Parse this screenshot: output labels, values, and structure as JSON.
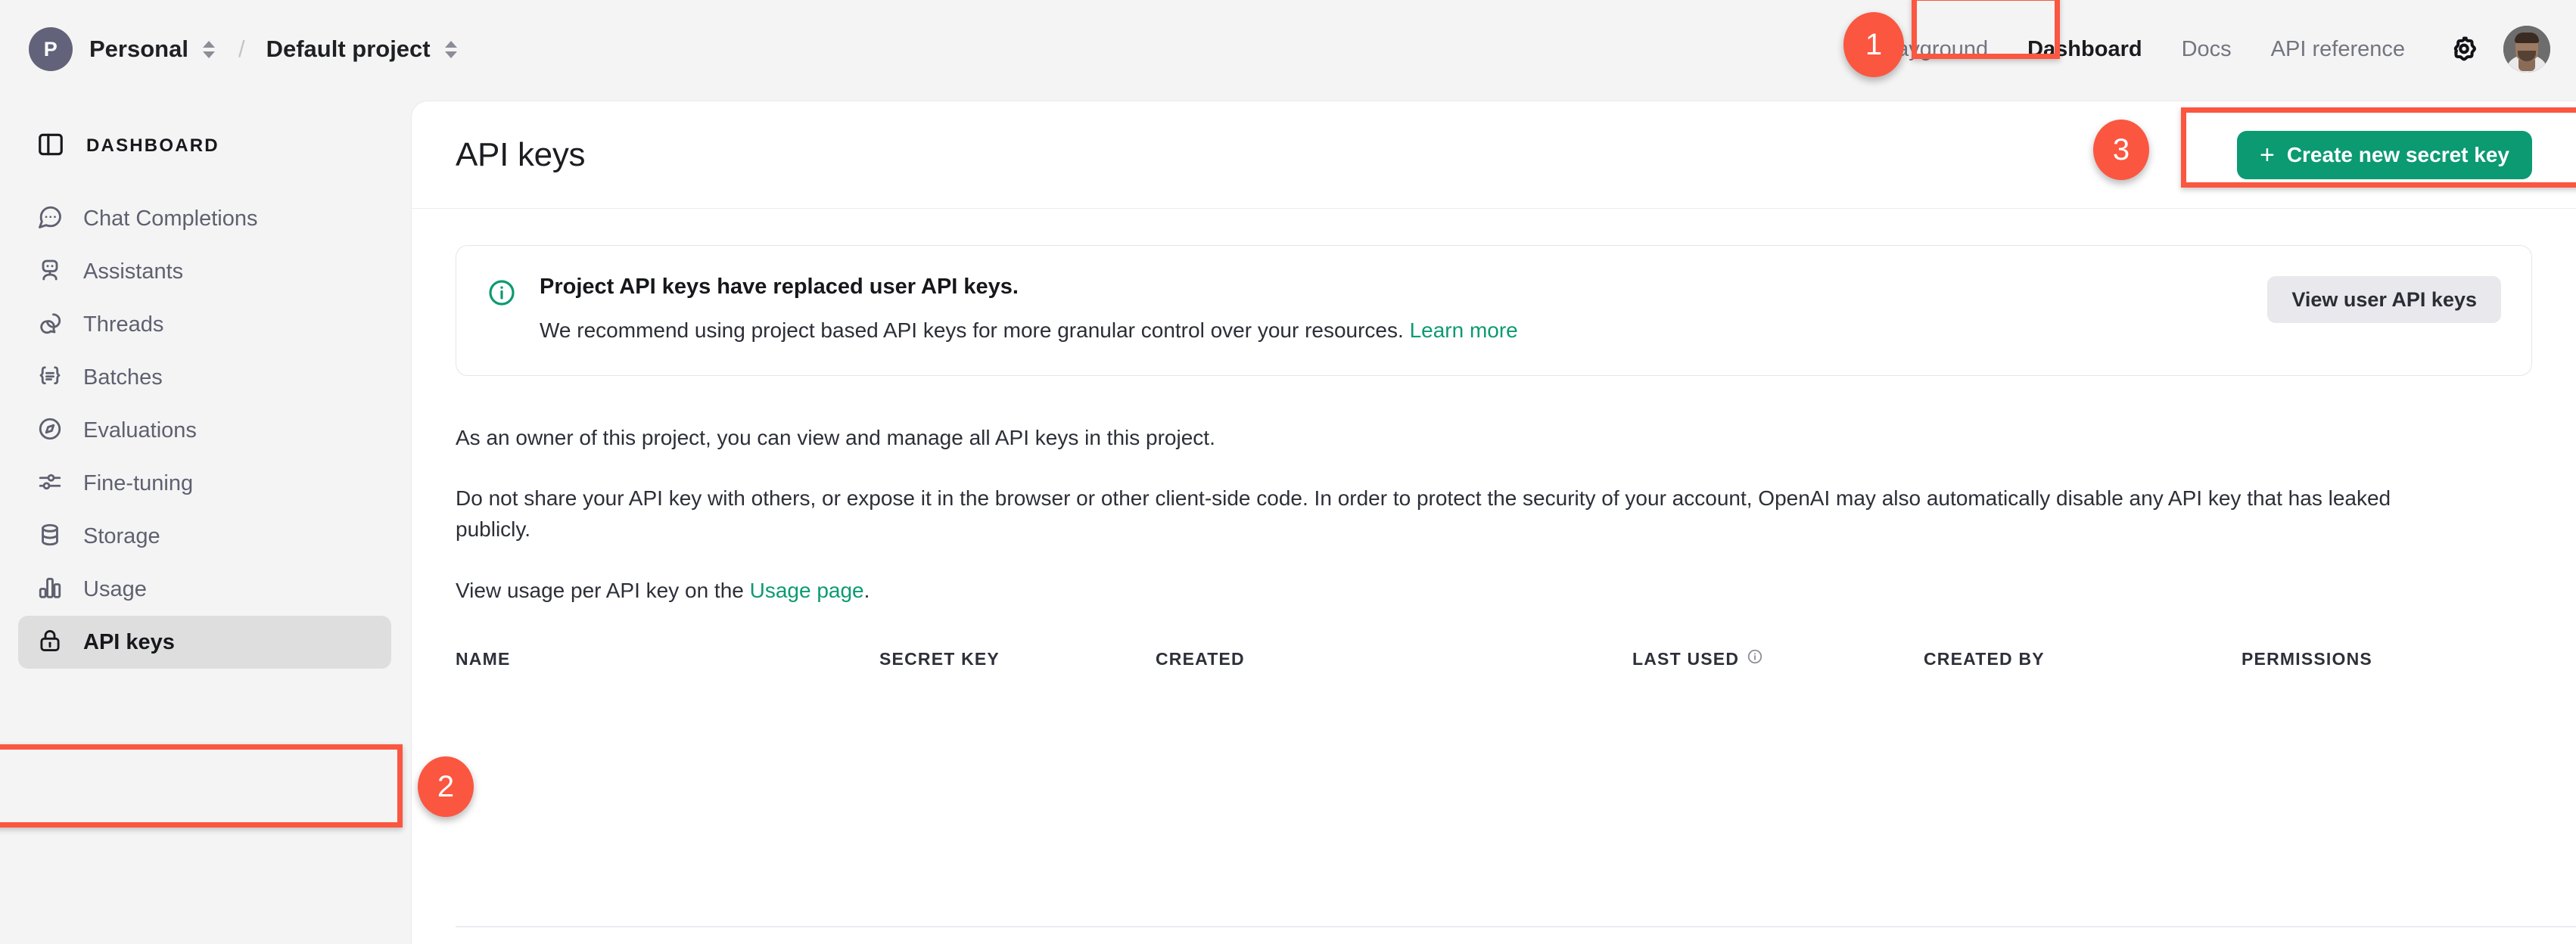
{
  "topbar": {
    "org": {
      "avatar_letter": "P",
      "name": "Personal",
      "switcher_icon": "chevron-updown-icon"
    },
    "separator": "/",
    "project": {
      "name": "Default project",
      "switcher_icon": "chevron-updown-icon"
    },
    "nav": [
      {
        "label": "Playground",
        "active": false
      },
      {
        "label": "Dashboard",
        "active": true
      },
      {
        "label": "Docs",
        "active": false
      },
      {
        "label": "API reference",
        "active": false
      }
    ],
    "settings_icon": "gear-icon",
    "avatar_icon": "user-avatar"
  },
  "sidebar": {
    "header": {
      "icon": "panel-layout-icon",
      "label": "DASHBOARD"
    },
    "items": [
      {
        "label": "Chat Completions",
        "icon": "chat-bubble-icon",
        "active": false
      },
      {
        "label": "Assistants",
        "icon": "robot-icon",
        "active": false
      },
      {
        "label": "Threads",
        "icon": "threads-icon",
        "active": false
      },
      {
        "label": "Batches",
        "icon": "braces-icon",
        "active": false
      },
      {
        "label": "Evaluations",
        "icon": "compass-icon",
        "active": false
      },
      {
        "label": "Fine-tuning",
        "icon": "sliders-icon",
        "active": false
      },
      {
        "label": "Storage",
        "icon": "database-icon",
        "active": false
      },
      {
        "label": "Usage",
        "icon": "bar-chart-icon",
        "active": false
      },
      {
        "label": "API keys",
        "icon": "lock-icon",
        "active": true
      }
    ]
  },
  "main": {
    "title": "API keys",
    "create_button": {
      "plus": "+",
      "label": "Create new secret key"
    },
    "banner": {
      "icon": "info-circle-icon",
      "title": "Project API keys have replaced user API keys.",
      "text_before_link": "We recommend using project based API keys for more granular control over your resources. ",
      "link_label": "Learn more",
      "action_label": "View user API keys"
    },
    "paragraphs": {
      "p1": "As an owner of this project, you can view and manage all API keys in this project.",
      "p2": "Do not share your API key with others, or expose it in the browser or other client-side code. In order to protect the security of your account, OpenAI may also automatically disable any API key that has leaked publicly.",
      "p3_before": "View usage per API key on the ",
      "p3_link": "Usage page",
      "p3_after": "."
    },
    "table": {
      "columns": [
        {
          "label": "NAME",
          "info_icon": false
        },
        {
          "label": "SECRET KEY",
          "info_icon": false
        },
        {
          "label": "CREATED",
          "info_icon": false
        },
        {
          "label": "LAST USED",
          "info_icon": true
        },
        {
          "label": "CREATED BY",
          "info_icon": false
        },
        {
          "label": "PERMISSIONS",
          "info_icon": false
        }
      ],
      "rows": []
    }
  },
  "annotations": {
    "accent_color": "#fb5640",
    "steps": [
      {
        "number": "1",
        "target": "dashboard-nav-link"
      },
      {
        "number": "2",
        "target": "sidebar-item-api-keys"
      },
      {
        "number": "3",
        "target": "create-new-secret-key-button"
      }
    ]
  },
  "colors": {
    "brand_green": "#0c9a72",
    "annotation_red": "#fb5640",
    "sidebar_bg": "#f4f4f4",
    "panel_bg": "#ffffff",
    "active_item_bg": "#dededf"
  }
}
